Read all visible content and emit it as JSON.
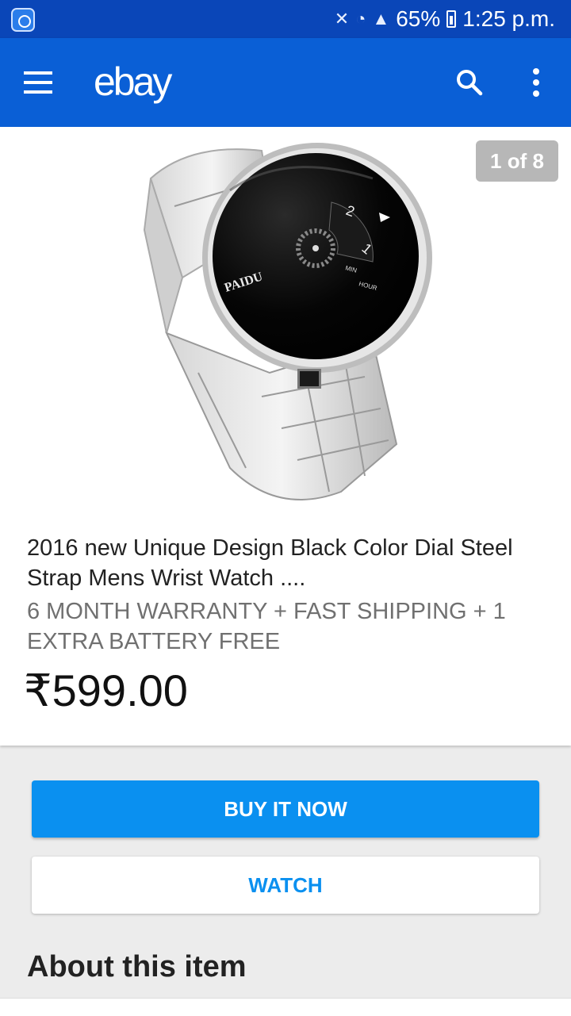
{
  "status_bar": {
    "battery": "65%",
    "time": "1:25 p.m.",
    "icons": [
      "app-notification-icon",
      "vibrate-mute-icon",
      "wifi-icon",
      "signal-icon",
      "battery-charging-icon"
    ]
  },
  "app_bar": {
    "logo": "ebay",
    "icons": [
      "menu-icon",
      "search-icon",
      "more-vert-icon"
    ]
  },
  "listing": {
    "image_counter": "1 of 8",
    "watch_dial": {
      "brand": "PAIDU",
      "min_label": "MIN",
      "hour_label": "HOUR",
      "hour_digits": [
        "2",
        "1"
      ]
    },
    "title": "2016 new Unique Design Black Color Dial Steel Strap Mens Wrist Watch ....",
    "subtitle": "6 MONTH WARRANTY + FAST SHIPPING + 1 EXTRA BATTERY FREE",
    "price": "₹599.00"
  },
  "actions": {
    "buy_label": "BUY IT NOW",
    "watch_label": "WATCH"
  },
  "about_heading": "About this item",
  "colors": {
    "status_bar": "#0a46b8",
    "app_bar": "#0a5fd6",
    "primary_button": "#0a90f0"
  }
}
